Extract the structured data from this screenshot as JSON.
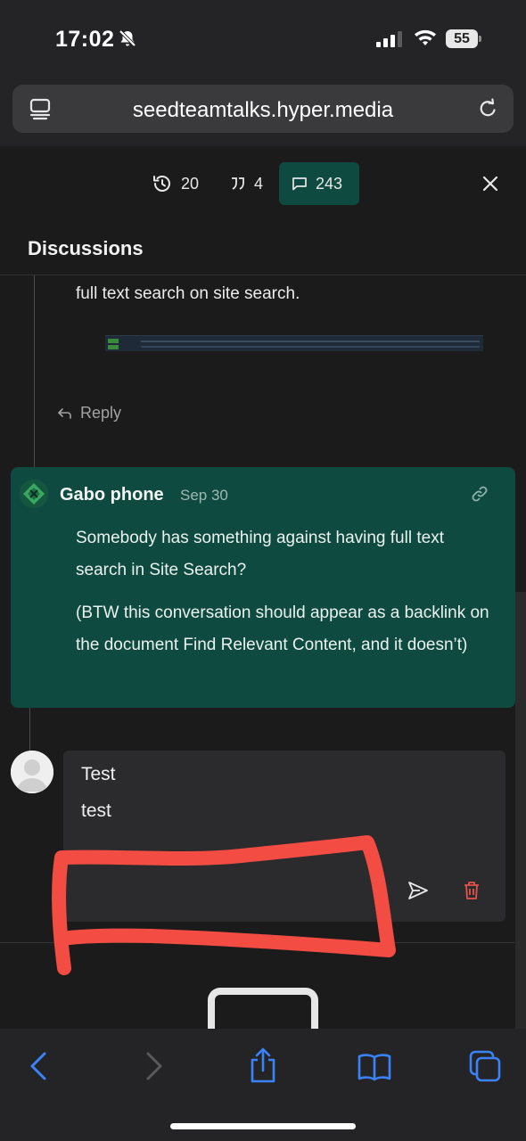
{
  "status_bar": {
    "time": "17:02",
    "battery": "55"
  },
  "browser": {
    "url": "seedteamtalks.hyper.media"
  },
  "panel": {
    "versions_count": "20",
    "citations_count": "4",
    "comments_count": "243",
    "title": "Discussions"
  },
  "previous_comment": {
    "text_tail": "full text search on site search.",
    "reply_label": "Reply"
  },
  "highlighted_comment": {
    "author": "Gabo phone",
    "date": "Sep 30",
    "paragraphs": [
      "Somebody has something against having full text search in Site Search?",
      "(BTW this conversation should appear as a backlink on the document Find Relevant Content, and it doesn’t)"
    ]
  },
  "draft": {
    "lines": [
      "Test",
      "test"
    ]
  },
  "colors": {
    "accent": "#0f4a40",
    "annotation": "#f24c43",
    "delete": "#e5534b",
    "toolbar_blue": "#3a82f7"
  },
  "icons": [
    "bell-slash-icon",
    "signal-icon",
    "wifi-icon",
    "tabs-icon",
    "reload-icon",
    "history-icon",
    "quote-icon",
    "comment-icon",
    "close-icon",
    "reply-arrow-icon",
    "link-icon",
    "send-icon",
    "trash-icon",
    "back-icon",
    "forward-icon",
    "share-icon",
    "bookmarks-icon",
    "tab-overview-icon"
  ]
}
